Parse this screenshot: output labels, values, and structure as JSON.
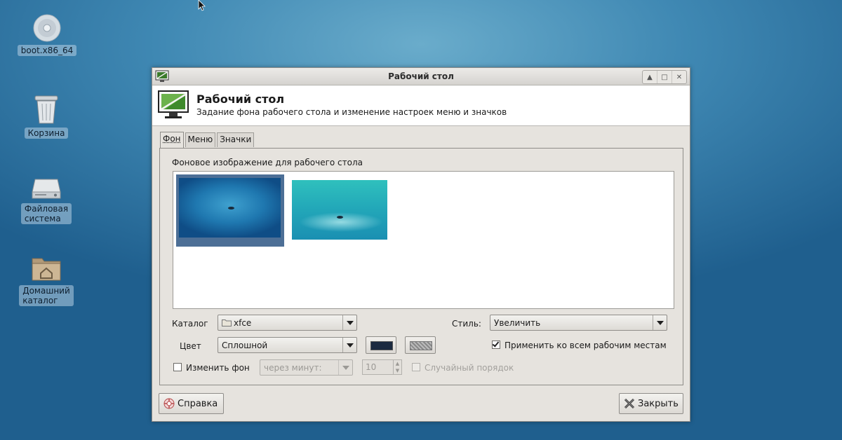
{
  "desktop": {
    "icons": [
      {
        "label": "boot.x86_64"
      },
      {
        "label": "Корзина"
      },
      {
        "label": "Файловая\nсистема"
      },
      {
        "label": "Домашний\nкаталог"
      }
    ]
  },
  "window": {
    "title": "Рабочий стол",
    "header_title": "Рабочий стол",
    "header_subtitle": "Задание фона рабочего стола и изменение настроек меню и значков",
    "tabs": [
      {
        "label": "Фон",
        "active": true
      },
      {
        "label": "Меню",
        "active": false
      },
      {
        "label": "Значки",
        "active": false
      }
    ],
    "background_label": "Фоновое изображение для рабочего стола",
    "folder_label": "Каталог",
    "folder_value": "xfce",
    "style_label": "Стиль:",
    "style_value": "Увеличить",
    "color_label": "Цвет",
    "color_mode_value": "Сплошной",
    "primary_color": "#1c2a40",
    "apply_all_label": "Применить ко всем рабочим местам",
    "apply_all_checked": true,
    "change_bg_label": "Изменить фон",
    "change_bg_checked": false,
    "interval_unit_value": "через минут:",
    "interval_value": "10",
    "random_order_label": "Случайный порядок",
    "help_button": "Справка",
    "close_button": "Закрыть"
  },
  "colors": {
    "desktop_bg": "#3f88b3",
    "selection": "#4d6f96"
  }
}
